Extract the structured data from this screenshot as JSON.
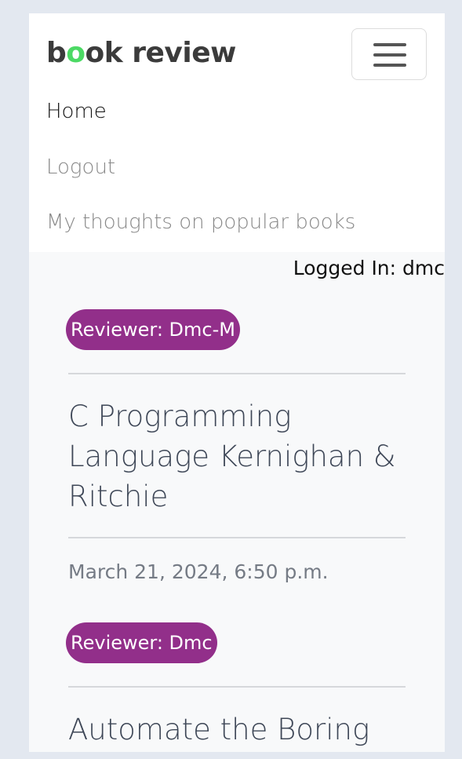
{
  "brand": {
    "prefix": "b",
    "accent": "o",
    "suffix": "ok review",
    "accent_color": "#4cd964"
  },
  "nav": {
    "items": [
      {
        "label": "Home",
        "active": true
      },
      {
        "label": "Logout",
        "active": false
      },
      {
        "label": "My thoughts on popular books",
        "active": false
      }
    ],
    "toggler_icon": "hamburger-icon"
  },
  "user": {
    "logged_in_text": "Logged In: dmc"
  },
  "posts": [
    {
      "reviewer": "Reviewer: Dmc-M",
      "title": "C Programming Language Kernighan & Ritchie",
      "date": "March 21, 2024, 6:50 p.m."
    },
    {
      "reviewer": "Reviewer: Dmc",
      "title": "Automate the Boring"
    }
  ],
  "colors": {
    "badge": "#922f8a",
    "page_bg": "#e3e8f0"
  }
}
